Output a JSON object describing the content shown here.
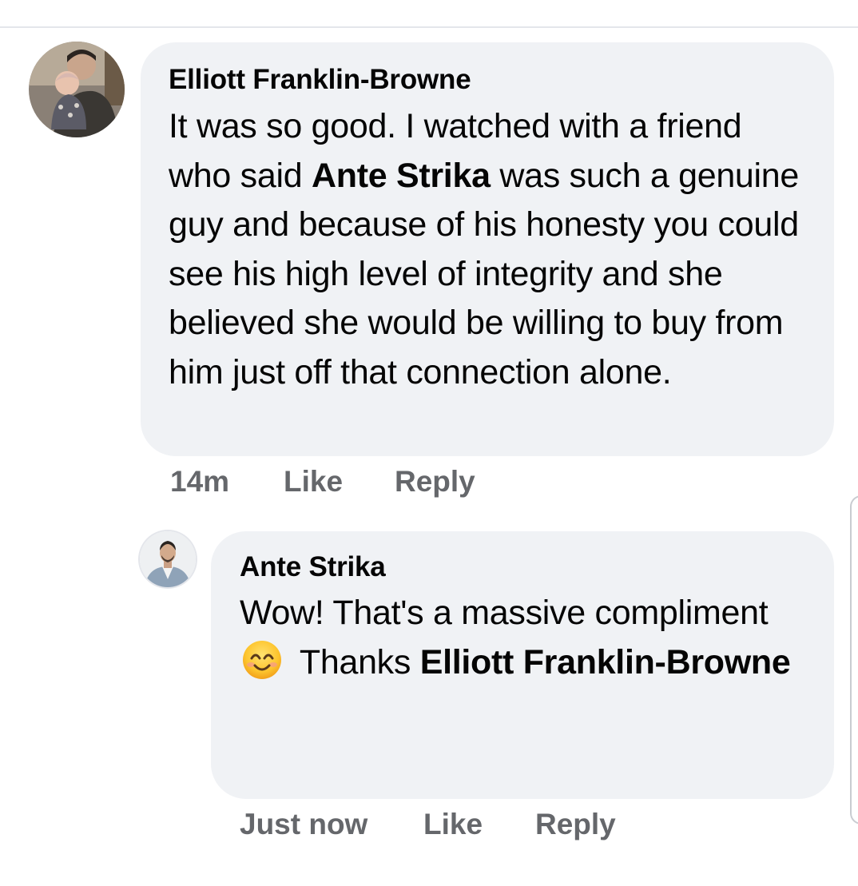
{
  "comments": [
    {
      "author": "Elliott Franklin-Browne",
      "text_parts": [
        "It was so good. I watched with a friend who said ",
        "Ante Strika",
        " was such a genuine guy and because of his honesty you could see his high level of integrity and she believed she would be willing to buy from him just off that connection alone."
      ],
      "time": "14m",
      "like_label": "Like",
      "reply_label": "Reply",
      "avatar_icon": "user-photo-avatar"
    },
    {
      "author": "Ante Strika",
      "text_parts": [
        "Wow! That's a massive compliment ",
        " Thanks ",
        "Elliott Franklin-Browne"
      ],
      "emoji_icon": "smiling-face-emoji-icon",
      "time": "Just now",
      "like_label": "Like",
      "reply_label": "Reply",
      "avatar_icon": "user-photo-avatar"
    }
  ],
  "colors": {
    "bubble": "#f0f2f5",
    "meta_text": "#65676b",
    "text": "#050505"
  }
}
